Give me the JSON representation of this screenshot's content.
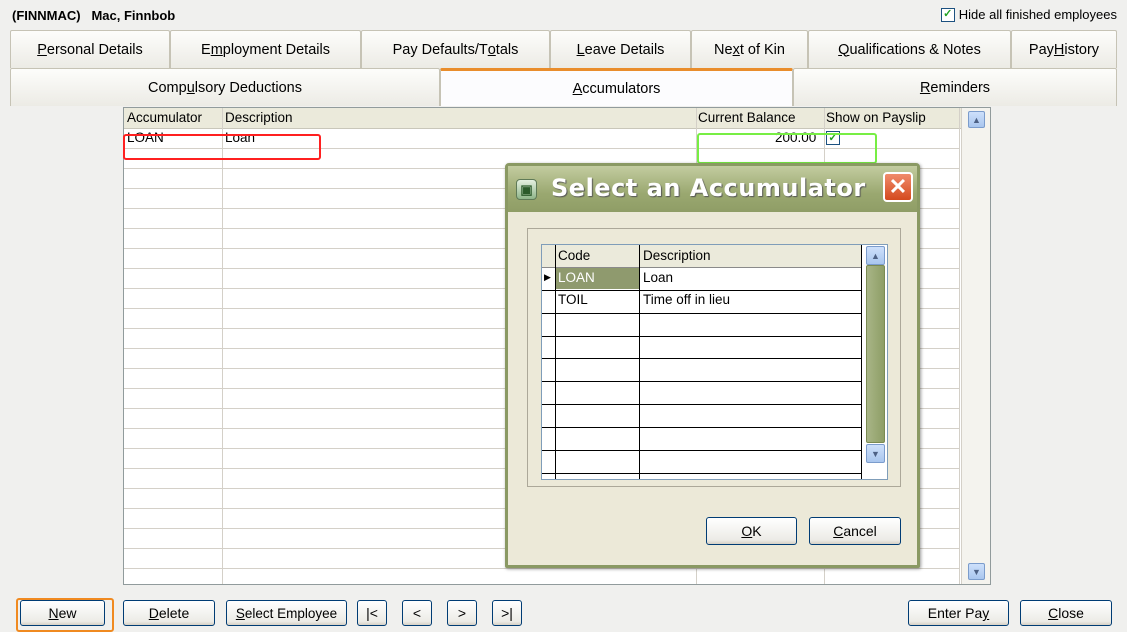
{
  "header": {
    "employee_code": "(FINNMAC)",
    "employee_name": "Mac, Finnbob",
    "hide_finished_label": "Hide all finished employees",
    "hide_finished_checked": true
  },
  "tabs_row1": [
    {
      "pre": "",
      "mn": "P",
      "post": "ersonal Details"
    },
    {
      "pre": "E",
      "mn": "m",
      "post": "ployment Details"
    },
    {
      "pre": "Pay Defaults/T",
      "mn": "o",
      "post": "tals"
    },
    {
      "pre": "",
      "mn": "L",
      "post": "eave Details"
    },
    {
      "pre": "Ne",
      "mn": "x",
      "post": "t of Kin"
    },
    {
      "pre": "",
      "mn": "Q",
      "post": "ualifications & Notes"
    },
    {
      "pre": "Pay ",
      "mn": "H",
      "post": "istory"
    }
  ],
  "tabs_row2": [
    {
      "pre": "Comp",
      "mn": "u",
      "post": "lsory Deductions"
    },
    {
      "pre": "",
      "mn": "A",
      "post": "ccumulators"
    },
    {
      "pre": "",
      "mn": "R",
      "post": "eminders"
    }
  ],
  "grid": {
    "columns": [
      "Accumulator",
      "Description",
      "Current Balance",
      "Show on Payslip"
    ],
    "rows": [
      {
        "accumulator": "LOAN",
        "description": "Loan",
        "balance": "200.00",
        "show_on_payslip": true
      }
    ]
  },
  "dialog": {
    "title": "Select an Accumulator",
    "close_glyph": "✕",
    "columns": [
      "Code",
      "Description"
    ],
    "rows": [
      {
        "code": "LOAN",
        "description": "Loan",
        "selected": true
      },
      {
        "code": "TOIL",
        "description": "Time off in lieu",
        "selected": false
      }
    ],
    "ok": {
      "mn": "O",
      "post": "K"
    },
    "cancel": {
      "mn": "C",
      "post": "ancel"
    }
  },
  "toolbar": {
    "new": {
      "mn": "N",
      "post": "ew"
    },
    "delete": {
      "mn": "D",
      "post": "elete"
    },
    "select_employee": {
      "mn": "S",
      "post": "elect Employee"
    },
    "first": "|<",
    "prev": "<",
    "next": ">",
    "last": ">|",
    "enter_pay": {
      "pre": "Enter Pa",
      "mn": "y",
      "post": ""
    },
    "close": {
      "mn": "C",
      "post": "lose"
    }
  },
  "colors": {
    "active_tab_accent": "#e98d2c",
    "highlight_red": "#ff2020",
    "highlight_green": "#77ee44",
    "highlight_orange": "#f08a20",
    "dialog_title_bar": "#9aa870"
  }
}
